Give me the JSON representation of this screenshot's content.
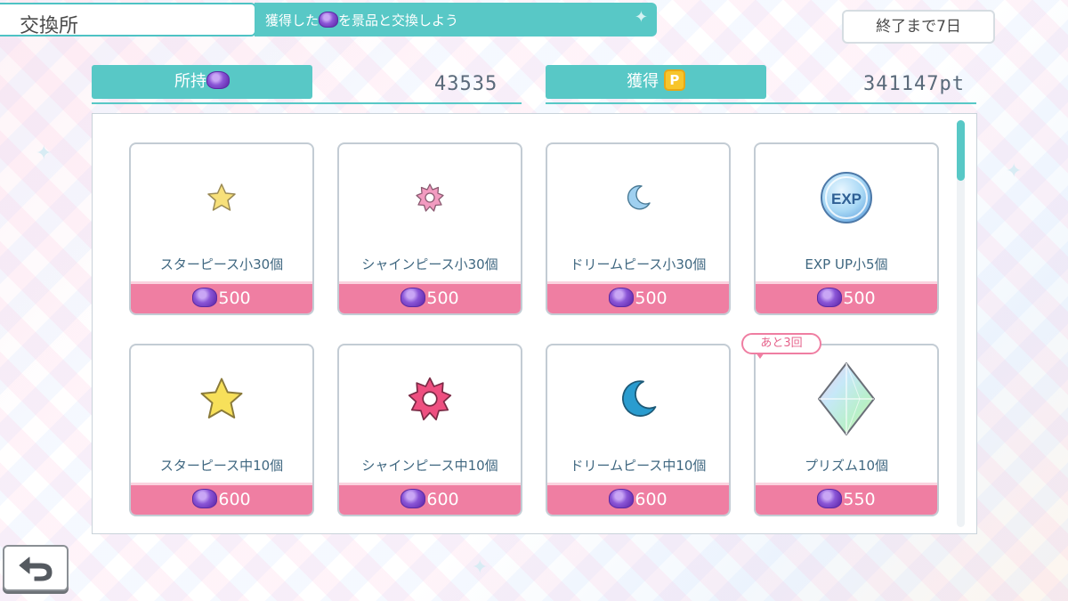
{
  "header": {
    "title": "交換所",
    "subtitle_before": "獲得した",
    "subtitle_after": "を景品と交換しよう",
    "end_label": "終了まで7日"
  },
  "balances": {
    "owned_label": "所持",
    "owned_value": "43535",
    "earned_label": "獲得",
    "earned_icon_letter": "P",
    "earned_value": "341147pt"
  },
  "items": [
    {
      "name": "スターピース小30個",
      "price": "500",
      "icon": "star-small-icon",
      "color": "#f7e07a"
    },
    {
      "name": "シャインピース小30個",
      "price": "500",
      "icon": "sun-small-icon",
      "color": "#f29bc0"
    },
    {
      "name": "ドリームピース小30個",
      "price": "500",
      "icon": "moon-small-icon",
      "color": "#9fd0f0"
    },
    {
      "name": "EXP UP小5個",
      "price": "500",
      "icon": "exp-icon",
      "color": "#5aa7e8"
    },
    {
      "name": "スターピース中10個",
      "price": "600",
      "icon": "star-medium-icon",
      "color": "#f7e05a"
    },
    {
      "name": "シャインピース中10個",
      "price": "600",
      "icon": "sun-medium-icon",
      "color": "#ee4f80"
    },
    {
      "name": "ドリームピース中10個",
      "price": "600",
      "icon": "moon-medium-icon",
      "color": "#2a9ccf"
    },
    {
      "name": "プリズム10個",
      "price": "550",
      "icon": "prism-icon",
      "color": "#b8e8f0"
    }
  ],
  "limit_badge": "あと3回",
  "colors": {
    "accent_teal": "#58c8c6",
    "price_pink": "#ef7ea2",
    "text_blue": "#3f6780"
  }
}
